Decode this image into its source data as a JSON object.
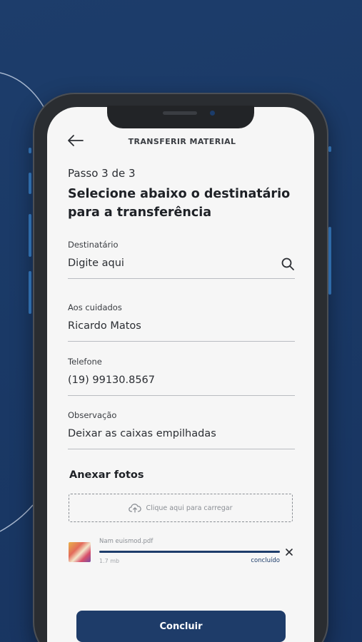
{
  "header": {
    "title": "TRANSFERIR MATERIAL",
    "back_icon": "arrow-left-icon"
  },
  "form": {
    "step": "Passo 3 de 3",
    "heading": "Selecione abaixo o destinatário para a transferência",
    "fields": [
      {
        "label": "Destinatário",
        "value": "Digite aqui",
        "icon": "search-icon"
      },
      {
        "label": "Aos cuidados",
        "value": "Ricardo Matos"
      },
      {
        "label": "Telefone",
        "value": "(19) 99130.8567"
      },
      {
        "label": "Observação",
        "value": "Deixar as caixas empilhadas"
      }
    ]
  },
  "attachments": {
    "title": "Anexar fotos",
    "dropzone_text": "Clique aqui para carregar",
    "dropzone_icon": "cloud-upload-icon",
    "file": {
      "name": "Nam euismod.pdf",
      "size": "1.7 mb",
      "status": "concluído",
      "progress": 1.0,
      "remove_icon": "close-icon"
    }
  },
  "actions": {
    "submit_label": "Concluir"
  },
  "colors": {
    "background": "#1d3d6b",
    "primary": "#1e3c69",
    "screen": "#f6f6f6",
    "accent_side_buttons": "#2e6aa8"
  }
}
